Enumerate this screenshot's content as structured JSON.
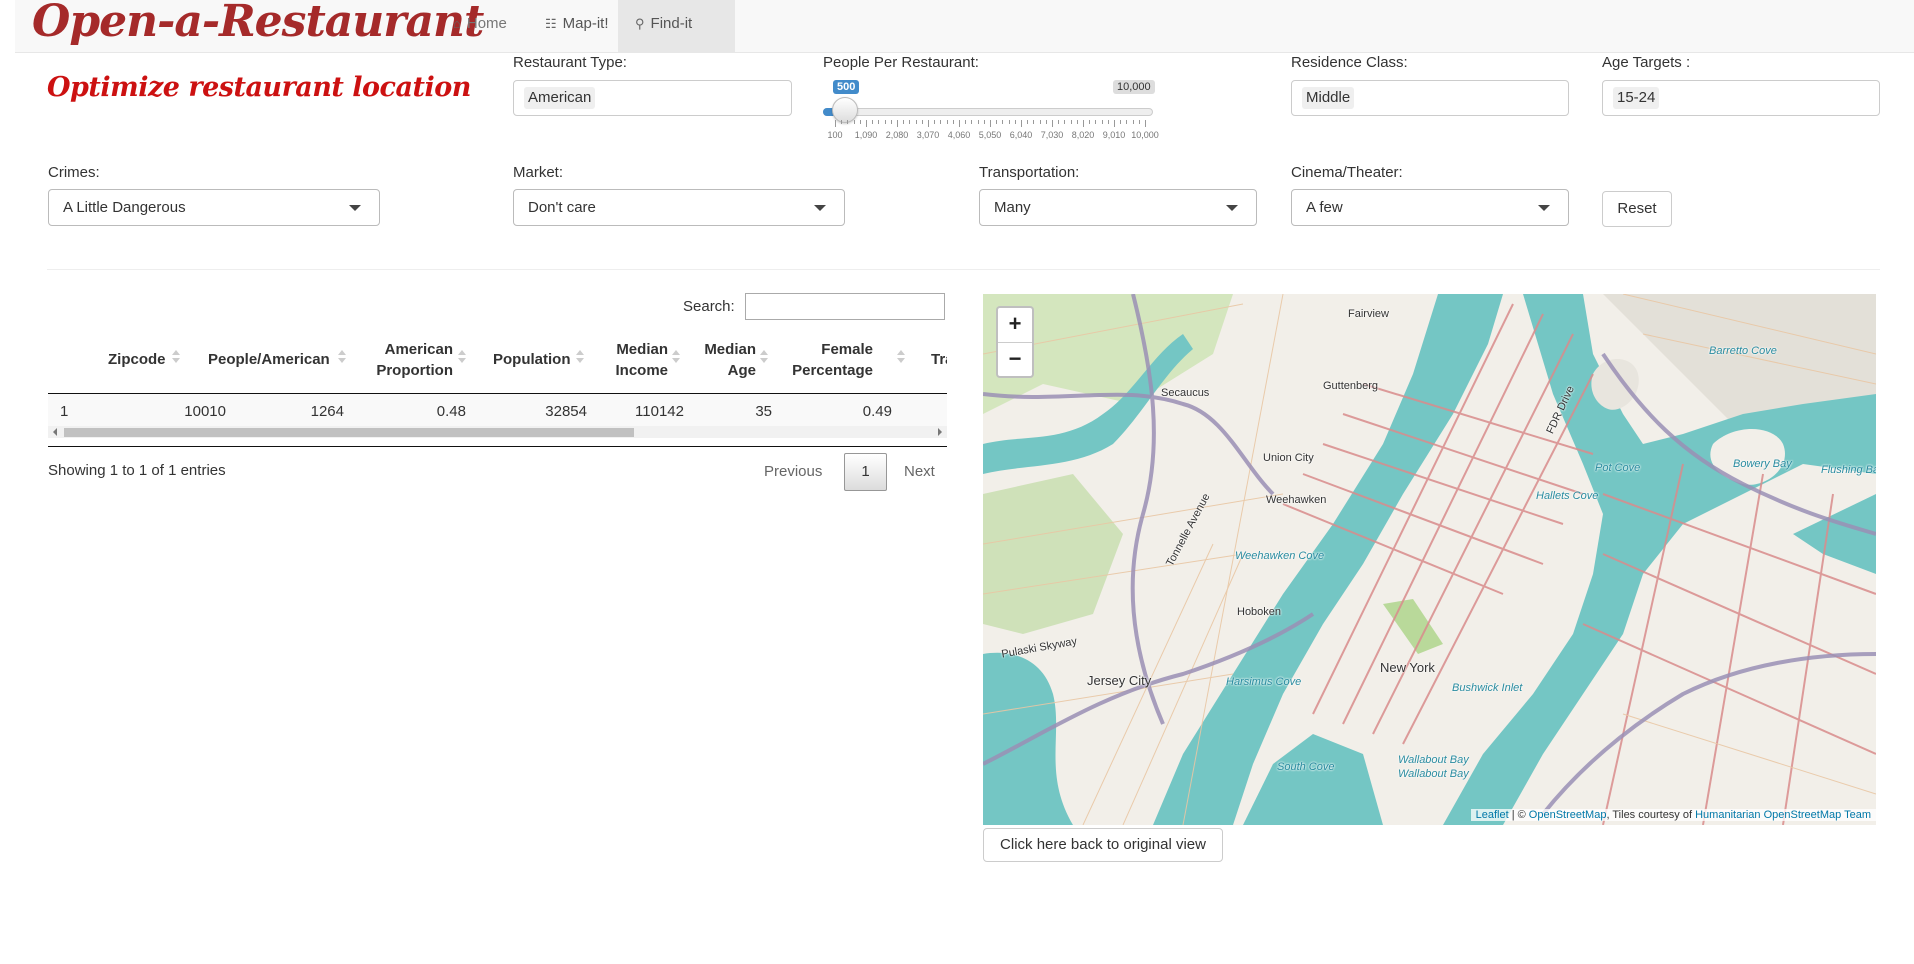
{
  "nav": {
    "brand": "Open-a-Restaurant",
    "tabs": [
      {
        "label": "Home",
        "icon": "home-icon"
      },
      {
        "label": "Map-it!",
        "icon": "map-icon"
      },
      {
        "label": "Find-it",
        "icon": "search-icon"
      }
    ]
  },
  "subtitle": "Optimize restaurant location",
  "filters": {
    "restaurant_type": {
      "label": "Restaurant Type:",
      "value": "American"
    },
    "people_per_restaurant": {
      "label": "People Per Restaurant:",
      "value": "500",
      "max_label": "10,000",
      "ticks": [
        "100",
        "1,090",
        "2,080",
        "3,070",
        "4,060",
        "5,050",
        "6,040",
        "7,030",
        "8,020",
        "9,010",
        "10,000"
      ]
    },
    "residence_class": {
      "label": "Residence Class:",
      "value": "Middle"
    },
    "age_targets": {
      "label": "Age Targets :",
      "value": "15-24"
    },
    "crimes": {
      "label": "Crimes:",
      "value": "A Little Dangerous"
    },
    "market": {
      "label": "Market:",
      "value": "Don't care"
    },
    "transportation": {
      "label": "Transportation:",
      "value": "Many"
    },
    "cinema": {
      "label": "Cinema/Theater:",
      "value": "A few"
    },
    "reset_label": "Reset"
  },
  "table": {
    "search_label": "Search:",
    "search_value": "",
    "headers": [
      "Zipcode",
      "People/American",
      "American Proportion",
      "Population",
      "Median Income",
      "Median Age",
      "Female Percentage",
      "Tra"
    ],
    "rows": [
      {
        "index": "1",
        "zipcode": "10010",
        "people": "1264",
        "proportion": "0.48",
        "population": "32854",
        "income": "110142",
        "age": "35",
        "female": "0.49"
      }
    ],
    "info": "Showing 1 to 1 of 1 entries",
    "prev": "Previous",
    "page": "1",
    "next": "Next"
  },
  "map": {
    "zoom_in": "+",
    "zoom_out": "−",
    "attribution_leaflet": "Leaflet",
    "attribution_sep": " | © ",
    "attribution_osm": "OpenStreetMap",
    "attribution_mid": ", Tiles courtesy of ",
    "attribution_hot": "Humanitarian OpenStreetMap Team",
    "labels": [
      "Fairview",
      "Barretto Cove",
      "Secaucus",
      "Guttenberg",
      "FDR Drive",
      "Union City",
      "Weehawken",
      "Pot Cove",
      "Bowery Bay",
      "Flushing Bay",
      "Hallets Cove",
      "Tonnelle Avenue",
      "Weehawken Cove",
      "Hoboken",
      "Pulaski Skyway",
      "Jersey City",
      "Harsimus Cove",
      "New York",
      "Bushwick Inlet",
      "South Cove",
      "Wallabout Bay",
      "Wallabout Bay"
    ],
    "reset_view_label": "Click here back to original view",
    "colors": {
      "water": "#74c6c4",
      "land": "#f2efe9",
      "park": "#c8dfa8",
      "major_road": "#d98c8c",
      "highway": "#9a8fb5"
    }
  }
}
